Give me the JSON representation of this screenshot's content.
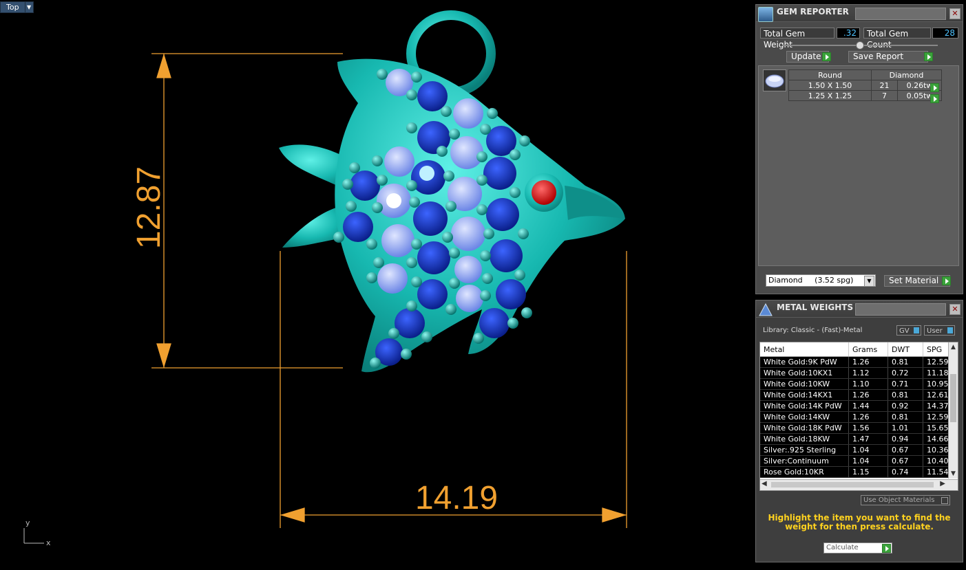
{
  "viewport": {
    "view_label": "Top",
    "dim_vertical": "12.87",
    "dim_horizontal": "14.19",
    "axis_y": "y",
    "axis_x": "x"
  },
  "gem_reporter": {
    "title": "GEM REPORTER",
    "total_weight_label": "Total Gem Weight",
    "total_weight_value": ".32",
    "total_count_label": "Total Gem Count",
    "total_count_value": "28",
    "update_label": "Update",
    "save_report_label": "Save Report",
    "table": {
      "header_shape": "Round",
      "header_material": "Diamond",
      "rows": [
        {
          "size": "1.50 X 1.50",
          "count": "21",
          "weight": "0.26tw"
        },
        {
          "size": "1.25 X 1.25",
          "count": "7",
          "weight": "0.05tw"
        }
      ]
    },
    "material_select": "Diamond     (3.52 spg)",
    "set_material_label": "Set Material"
  },
  "metal_weights": {
    "title": "METAL WEIGHTS",
    "library": "Library: Classic - (Fast)-Metal",
    "gv_label": "GV",
    "user_label": "User",
    "columns": [
      "Metal",
      "Grams",
      "DWT",
      "SPG"
    ],
    "rows": [
      [
        "White Gold:9K PdW",
        "1.26",
        "0.81",
        "12.59"
      ],
      [
        "White Gold:10KX1",
        "1.12",
        "0.72",
        "11.18"
      ],
      [
        "White Gold:10KW",
        "1.10",
        "0.71",
        "10.95"
      ],
      [
        "White Gold:14KX1",
        "1.26",
        "0.81",
        "12.61"
      ],
      [
        "White Gold:14K PdW",
        "1.44",
        "0.92",
        "14.37"
      ],
      [
        "White Gold:14KW",
        "1.26",
        "0.81",
        "12.59"
      ],
      [
        "White Gold:18K PdW",
        "1.56",
        "1.01",
        "15.65"
      ],
      [
        "White Gold:18KW",
        "1.47",
        "0.94",
        "14.66"
      ],
      [
        "Silver:.925 Sterling",
        "1.04",
        "0.67",
        "10.36"
      ],
      [
        "Silver:Continuum",
        "1.04",
        "0.67",
        "10.40"
      ],
      [
        "Rose Gold:10KR",
        "1.15",
        "0.74",
        "11.54"
      ]
    ],
    "use_object_materials": "Use Object Materials",
    "note": "Highlight the item you want to find the weight for then press calculate.",
    "calculate_label": "Calculate"
  }
}
